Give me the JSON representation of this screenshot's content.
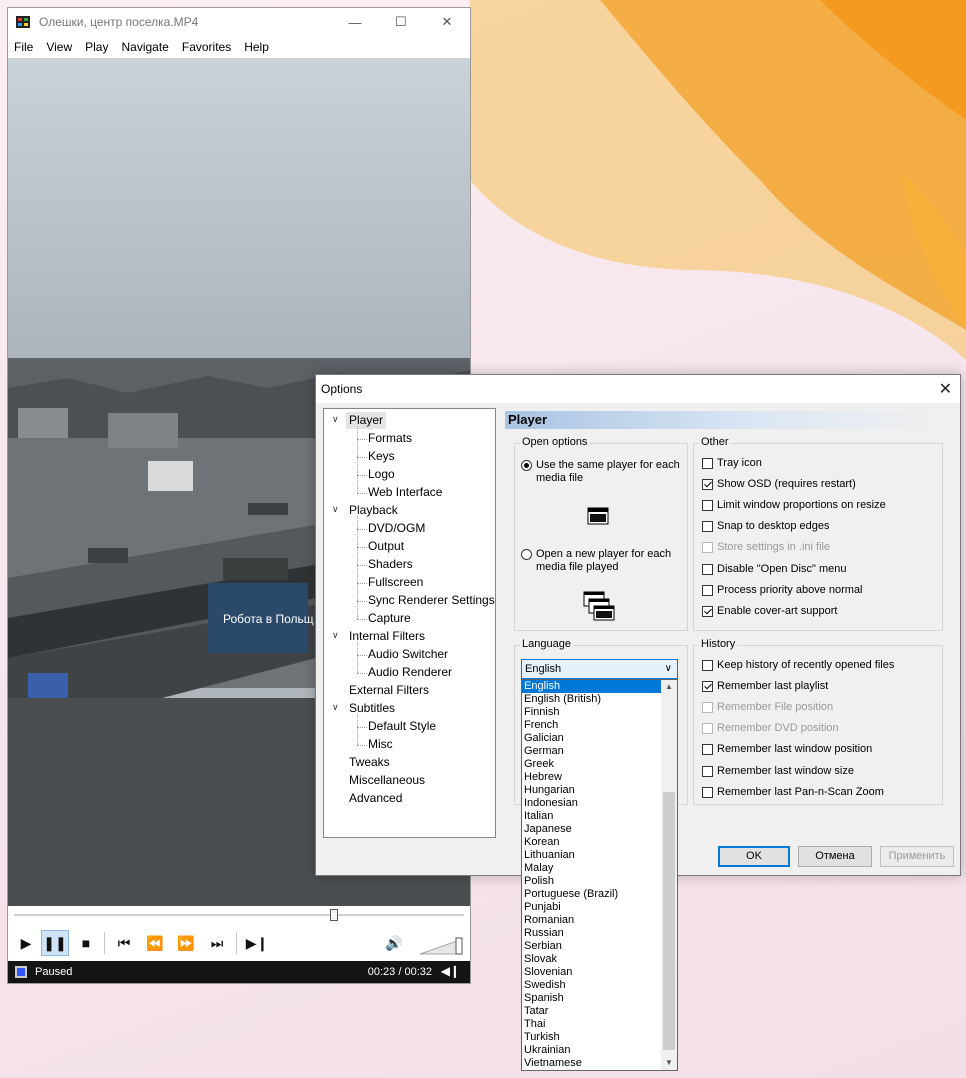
{
  "player": {
    "title": "Олешки, центр поселка.MP4",
    "menu": [
      "File",
      "View",
      "Play",
      "Navigate",
      "Favorites",
      "Help"
    ],
    "status": "Paused",
    "time": "00:23 / 00:32",
    "seek_fraction": 0.71,
    "video_overlay_text": "Робота в Польщ"
  },
  "options": {
    "title": "Options",
    "tree": [
      {
        "label": "Player",
        "level": 0,
        "expanded": true,
        "selected": true
      },
      {
        "label": "Formats",
        "level": 1
      },
      {
        "label": "Keys",
        "level": 1
      },
      {
        "label": "Logo",
        "level": 1
      },
      {
        "label": "Web Interface",
        "level": 1
      },
      {
        "label": "Playback",
        "level": 0,
        "expanded": true
      },
      {
        "label": "DVD/OGM",
        "level": 1
      },
      {
        "label": "Output",
        "level": 1
      },
      {
        "label": "Shaders",
        "level": 1
      },
      {
        "label": "Fullscreen",
        "level": 1
      },
      {
        "label": "Sync Renderer Settings",
        "level": 1
      },
      {
        "label": "Capture",
        "level": 1
      },
      {
        "label": "Internal Filters",
        "level": 0,
        "expanded": true
      },
      {
        "label": "Audio Switcher",
        "level": 1
      },
      {
        "label": "Audio Renderer",
        "level": 1
      },
      {
        "label": "External Filters",
        "level": 0
      },
      {
        "label": "Subtitles",
        "level": 0,
        "expanded": true
      },
      {
        "label": "Default Style",
        "level": 1
      },
      {
        "label": "Misc",
        "level": 1
      },
      {
        "label": "Tweaks",
        "level": 0
      },
      {
        "label": "Miscellaneous",
        "level": 0
      },
      {
        "label": "Advanced",
        "level": 0
      }
    ],
    "page_title": "Player",
    "open_options": {
      "label": "Open options",
      "same_player": "Use the same player for each media file",
      "new_player": "Open a new player for each media file played",
      "selected": "same_player"
    },
    "other": {
      "label": "Other",
      "items": [
        {
          "label": "Tray icon",
          "checked": false,
          "enabled": true
        },
        {
          "label": "Show OSD (requires restart)",
          "checked": true,
          "enabled": true
        },
        {
          "label": "Limit window proportions on resize",
          "checked": false,
          "enabled": true
        },
        {
          "label": "Snap to desktop edges",
          "checked": false,
          "enabled": true
        },
        {
          "label": "Store settings in .ini file",
          "checked": false,
          "enabled": false
        },
        {
          "label": "Disable \"Open Disc\" menu",
          "checked": false,
          "enabled": true
        },
        {
          "label": "Process priority above normal",
          "checked": false,
          "enabled": true
        },
        {
          "label": "Enable cover-art support",
          "checked": true,
          "enabled": true
        }
      ]
    },
    "language": {
      "label": "Language",
      "selected": "English",
      "options": [
        "English",
        "English (British)",
        "Finnish",
        "French",
        "Galician",
        "German",
        "Greek",
        "Hebrew",
        "Hungarian",
        "Indonesian",
        "Italian",
        "Japanese",
        "Korean",
        "Lithuanian",
        "Malay",
        "Polish",
        "Portuguese (Brazil)",
        "Punjabi",
        "Romanian",
        "Russian",
        "Serbian",
        "Slovak",
        "Slovenian",
        "Swedish",
        "Spanish",
        "Tatar",
        "Thai",
        "Turkish",
        "Ukrainian",
        "Vietnamese"
      ]
    },
    "history": {
      "label": "History",
      "items": [
        {
          "label": "Keep history of recently opened files",
          "checked": false,
          "enabled": true
        },
        {
          "label": "Remember last playlist",
          "checked": true,
          "enabled": true
        },
        {
          "label": "Remember File position",
          "checked": false,
          "enabled": false
        },
        {
          "label": "Remember DVD position",
          "checked": false,
          "enabled": false
        },
        {
          "label": "Remember last window position",
          "checked": false,
          "enabled": true
        },
        {
          "label": "Remember last window size",
          "checked": false,
          "enabled": true
        },
        {
          "label": "Remember last Pan-n-Scan Zoom",
          "checked": false,
          "enabled": true
        }
      ]
    },
    "buttons": {
      "ok": "OK",
      "cancel": "Отмена",
      "apply": "Применить"
    }
  }
}
